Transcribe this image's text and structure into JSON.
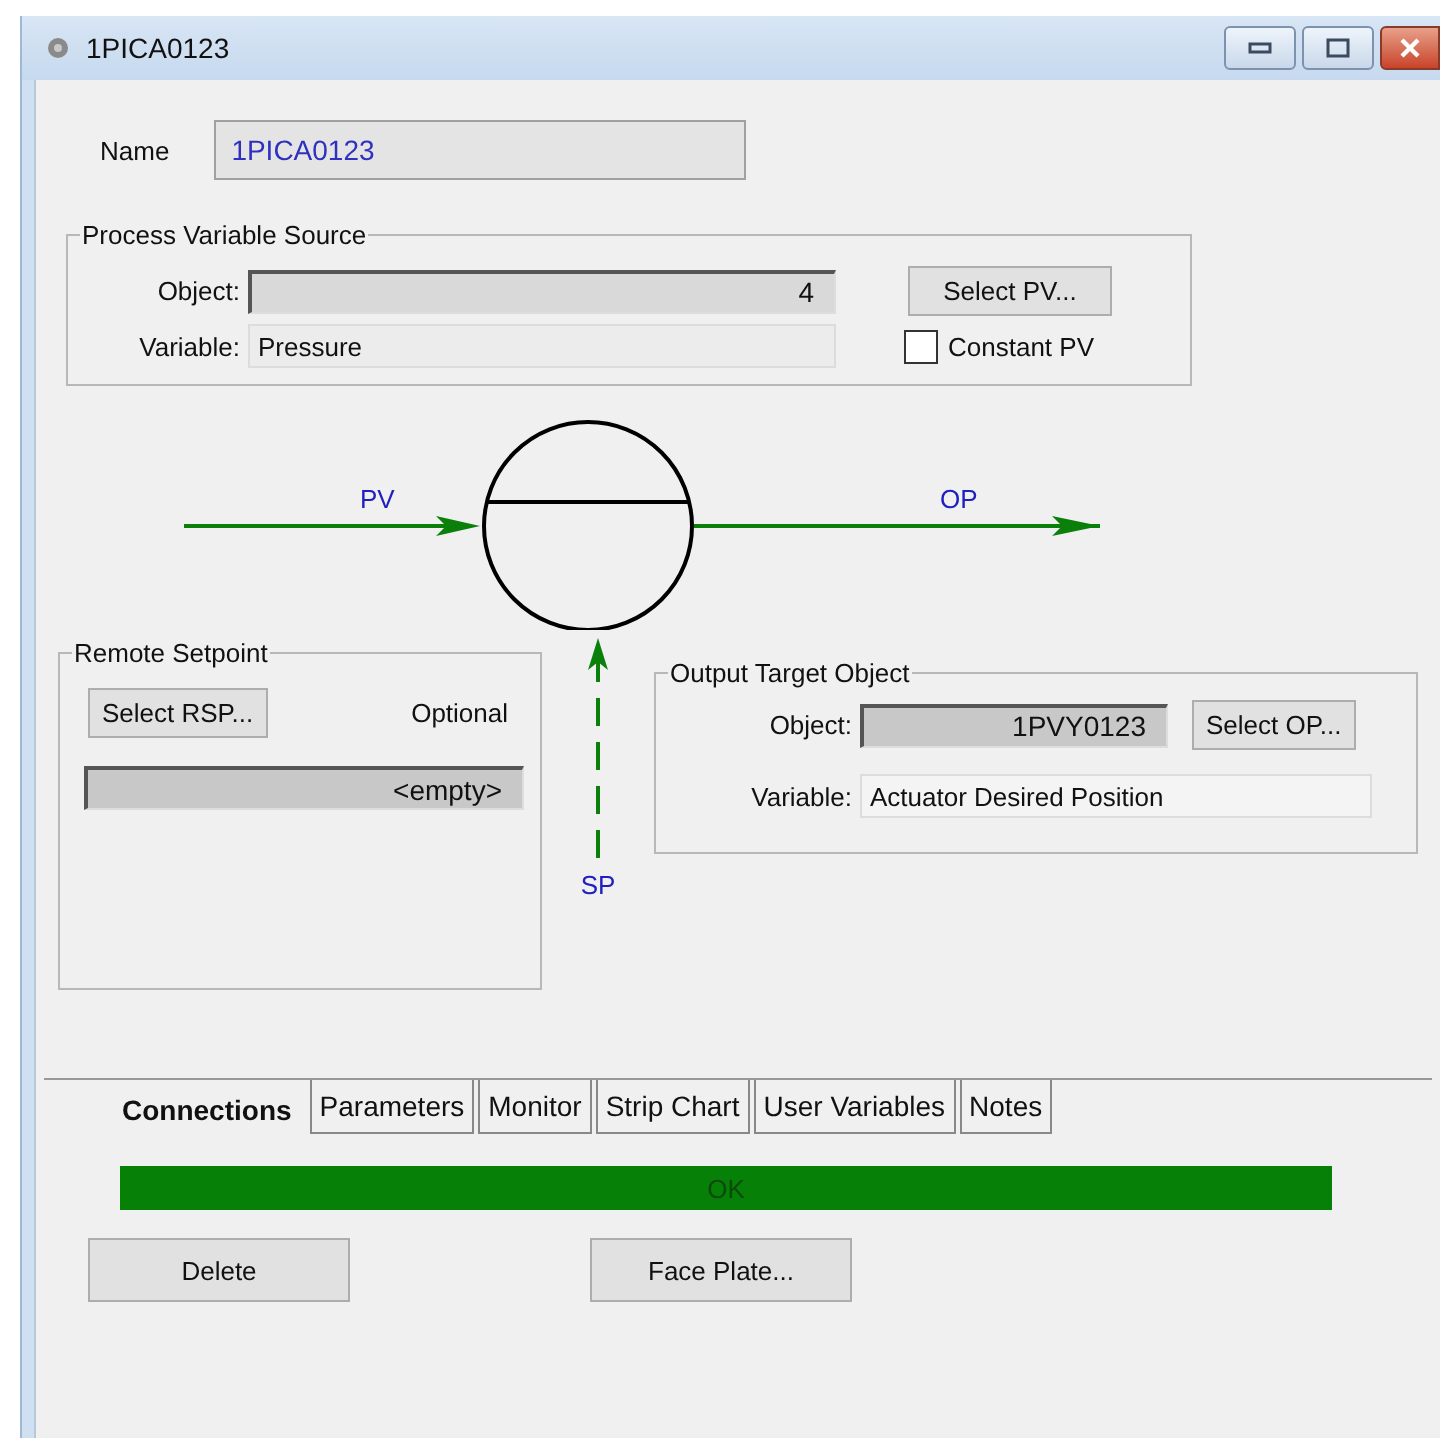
{
  "window": {
    "title": "1PICA0123"
  },
  "name": {
    "label": "Name",
    "value": "1PICA0123"
  },
  "pv_source": {
    "title": "Process Variable Source",
    "object_label": "Object:",
    "object_value": "4",
    "select_button": "Select PV...",
    "variable_label": "Variable:",
    "variable_value": "Pressure",
    "constant_pv": {
      "label": "Constant PV",
      "checked": false
    }
  },
  "diagram": {
    "pv_label": "PV",
    "op_label": "OP",
    "sp_label": "SP"
  },
  "remote_setpoint": {
    "title": "Remote Setpoint",
    "select_button": "Select RSP...",
    "optional_label": "Optional",
    "value": "<empty>"
  },
  "output_target": {
    "title": "Output Target Object",
    "object_label": "Object:",
    "object_value": "1PVY0123",
    "select_button": "Select OP...",
    "variable_label": "Variable:",
    "variable_value": "Actuator Desired Position"
  },
  "tabs": [
    {
      "label": "Connections",
      "selected": true
    },
    {
      "label": "Parameters",
      "selected": false
    },
    {
      "label": "Monitor",
      "selected": false
    },
    {
      "label": "Strip Chart",
      "selected": false
    },
    {
      "label": "User Variables",
      "selected": false
    },
    {
      "label": "Notes",
      "selected": false
    }
  ],
  "status": {
    "text": "OK"
  },
  "buttons": [
    "Delete",
    "Face Plate..."
  ]
}
